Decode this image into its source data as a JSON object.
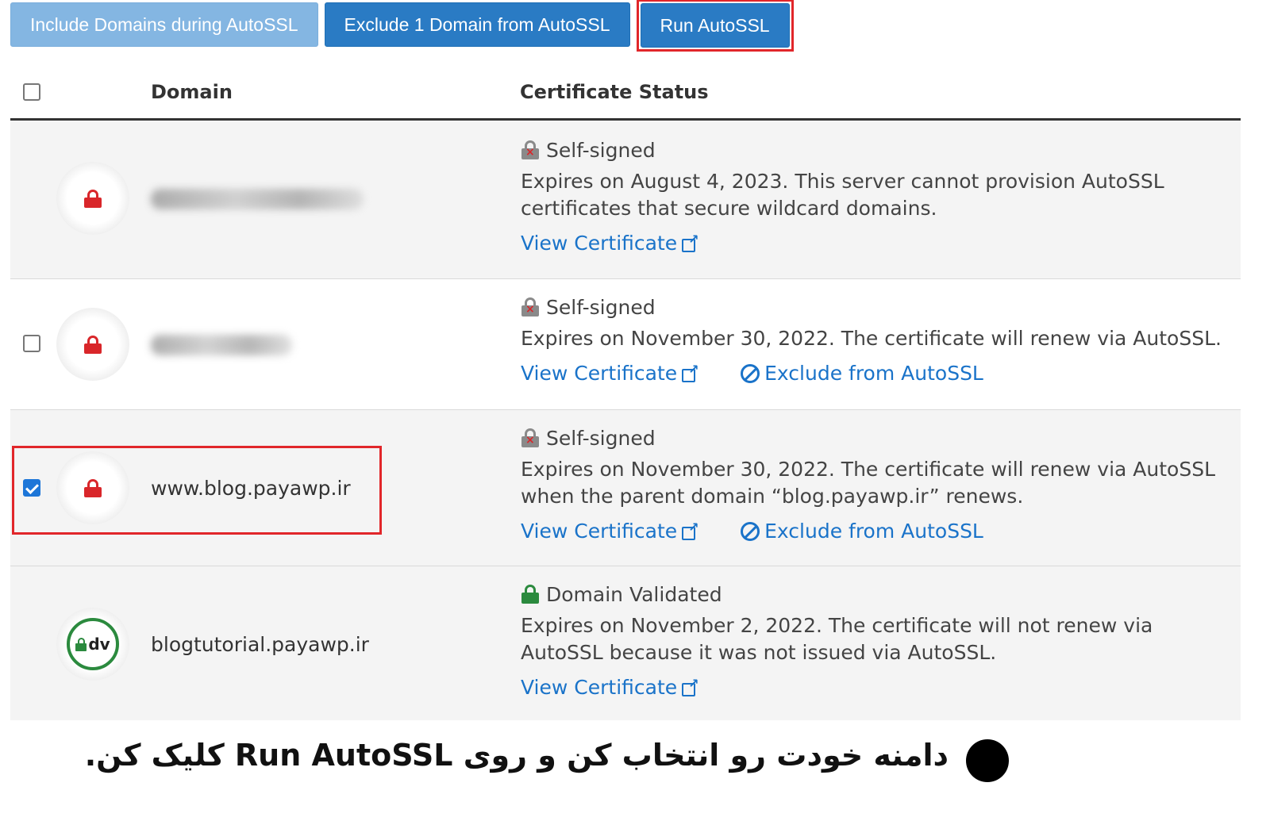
{
  "toolbar": {
    "include_label": "Include Domains during AutoSSL",
    "exclude_label": "Exclude 1 Domain from AutoSSL",
    "run_label": "Run AutoSSL"
  },
  "table": {
    "col_domain": "Domain",
    "col_status": "Certificate Status",
    "rows": [
      {
        "domain": "",
        "status": "Self-signed",
        "description": "Expires on August 4, 2023. This server cannot provision AutoSSL certificates that secure wildcard domains.",
        "view_label": "View Certificate"
      },
      {
        "domain": "",
        "status": "Self-signed",
        "description": "Expires on November 30, 2022. The certificate will renew via AutoSSL.",
        "view_label": "View Certificate",
        "exclude_label": "Exclude from AutoSSL"
      },
      {
        "domain": "www.blog.payawp.ir",
        "status": "Self-signed",
        "description": "Expires on November 30, 2022. The certificate will renew via AutoSSL when the parent domain “blog.payawp.ir” renews.",
        "view_label": "View Certificate",
        "exclude_label": "Exclude from AutoSSL"
      },
      {
        "domain": "blogtutorial.payawp.ir",
        "status": "Domain Validated",
        "badge": "dv",
        "description": "Expires on November 2, 2022. The certificate will not renew via AutoSSL because it was not issued via AutoSSL.",
        "view_label": "View Certificate"
      }
    ]
  },
  "caption": "دامنه خودت رو انتخاب کن و روی Run AutoSSL کلیک کن.",
  "colors": {
    "primary_button": "#2a7bc4",
    "highlight": "#e1262a",
    "link": "#1a73c9",
    "lock_red": "#d9262a",
    "lock_green": "#2b8a3e"
  }
}
